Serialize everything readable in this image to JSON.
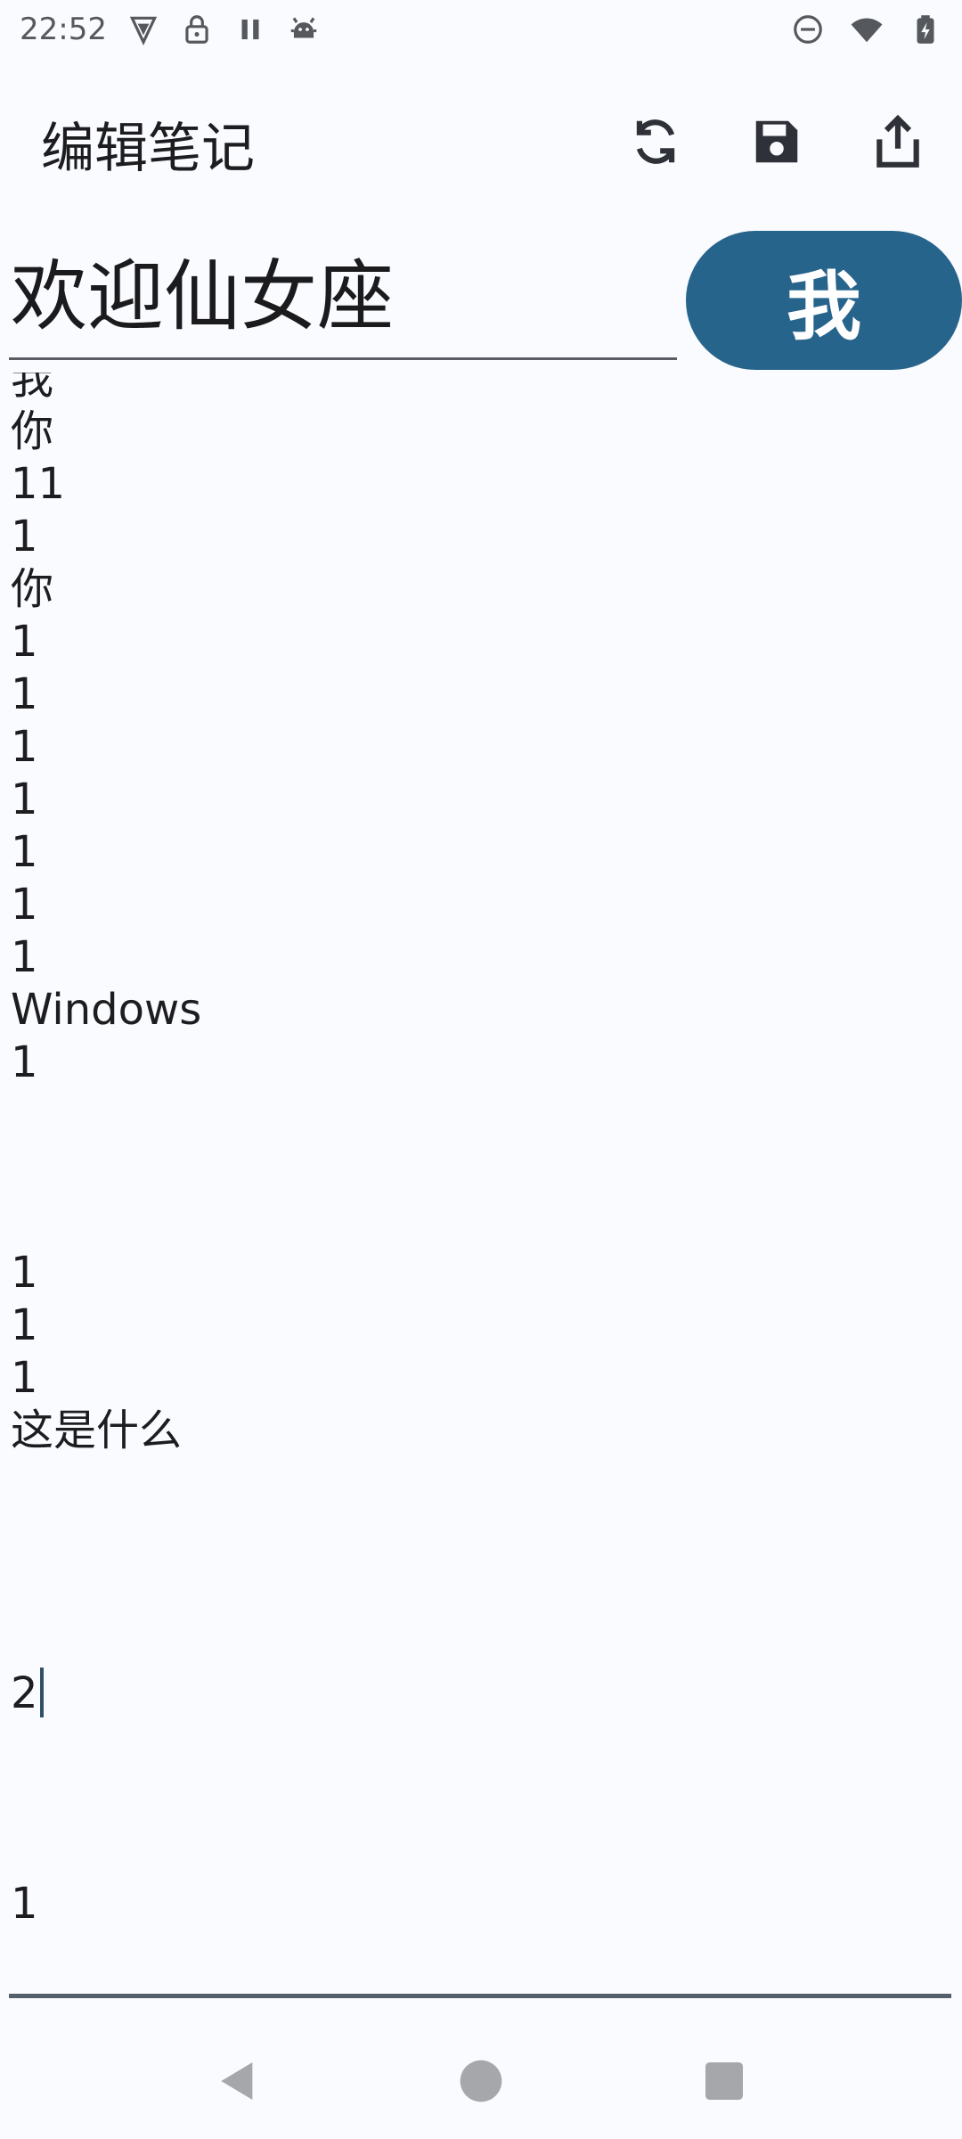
{
  "status_bar": {
    "time": "22:52",
    "icons": [
      "vpn-shield-icon",
      "lock-icon",
      "pause-icon",
      "android-debug-icon",
      "do-not-disturb-icon",
      "wifi-icon",
      "battery-charging-icon"
    ]
  },
  "app_bar": {
    "title": "编辑笔记",
    "actions": [
      "sync-icon",
      "save-icon",
      "share-icon"
    ]
  },
  "note": {
    "title": "欢迎仙女座",
    "avatar_label": "我",
    "lines": [
      "我",
      "你",
      "11",
      "1",
      "你",
      "1",
      "1",
      "1",
      "1",
      "1",
      "1",
      "1",
      "Windows",
      "1",
      "",
      "",
      "",
      "1",
      "1",
      "1",
      "这是什么",
      "",
      "",
      "",
      "",
      "2",
      "",
      "",
      "",
      "1"
    ]
  },
  "colors": {
    "accent": "#27648b",
    "background": "#fafbfe",
    "text": "#1d1d20"
  }
}
